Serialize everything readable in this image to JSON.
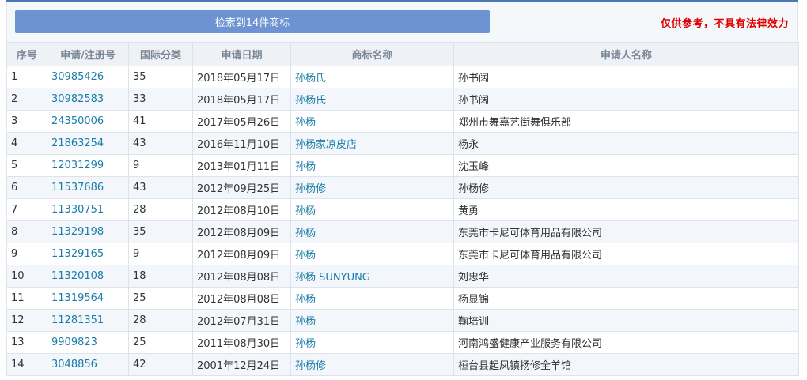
{
  "search": {
    "result_button_label": "检索到14件商标",
    "disclaimer": "仅供参考，不具有法律效力"
  },
  "table": {
    "headers": [
      "序号",
      "申请/注册号",
      "国际分类",
      "申请日期",
      "商标名称",
      "申请人名称"
    ],
    "rows": [
      {
        "no": "1",
        "reg": "30985426",
        "class": "35",
        "date": "2018年05月17日",
        "name": "孙杨氏",
        "applicant": "孙书阔"
      },
      {
        "no": "2",
        "reg": "30982583",
        "class": "33",
        "date": "2018年05月17日",
        "name": "孙杨氏",
        "applicant": "孙书阔"
      },
      {
        "no": "3",
        "reg": "24350006",
        "class": "41",
        "date": "2017年05月26日",
        "name": "孙杨",
        "applicant": "郑州市舞嘉艺街舞俱乐部"
      },
      {
        "no": "4",
        "reg": "21863254",
        "class": "43",
        "date": "2016年11月10日",
        "name": "孙杨家凉皮店",
        "applicant": "杨永"
      },
      {
        "no": "5",
        "reg": "12031299",
        "class": "9",
        "date": "2013年01月11日",
        "name": "孙杨",
        "applicant": "沈玉峰"
      },
      {
        "no": "6",
        "reg": "11537686",
        "class": "43",
        "date": "2012年09月25日",
        "name": "孙杨修",
        "applicant": "孙杨修"
      },
      {
        "no": "7",
        "reg": "11330751",
        "class": "28",
        "date": "2012年08月10日",
        "name": "孙杨",
        "applicant": "黄勇"
      },
      {
        "no": "8",
        "reg": "11329198",
        "class": "35",
        "date": "2012年08月09日",
        "name": "孙杨",
        "applicant": "东莞市卡尼可体育用品有限公司"
      },
      {
        "no": "9",
        "reg": "11329165",
        "class": "9",
        "date": "2012年08月09日",
        "name": "孙杨",
        "applicant": "东莞市卡尼可体育用品有限公司"
      },
      {
        "no": "10",
        "reg": "11320108",
        "class": "18",
        "date": "2012年08月08日",
        "name": "孙杨 SUNYUNG",
        "applicant": "刘忠华"
      },
      {
        "no": "11",
        "reg": "11319564",
        "class": "25",
        "date": "2012年08月08日",
        "name": "孙杨",
        "applicant": "杨显锦"
      },
      {
        "no": "12",
        "reg": "11281351",
        "class": "28",
        "date": "2012年07月31日",
        "name": "孙杨",
        "applicant": "鞠培训"
      },
      {
        "no": "13",
        "reg": "9909823",
        "class": "25",
        "date": "2011年08月30日",
        "name": "孙杨",
        "applicant": "河南鸿盛健康产业服务有限公司"
      },
      {
        "no": "14",
        "reg": "3048856",
        "class": "42",
        "date": "2001年12月24日",
        "name": "孙杨修",
        "applicant": "桓台县起凤镇扬修全羊馆"
      }
    ]
  },
  "colors": {
    "link": "#1a7da8",
    "button": "#6e93d3",
    "disclaimer": "#e00000",
    "header_bg": "#eef2f7"
  }
}
